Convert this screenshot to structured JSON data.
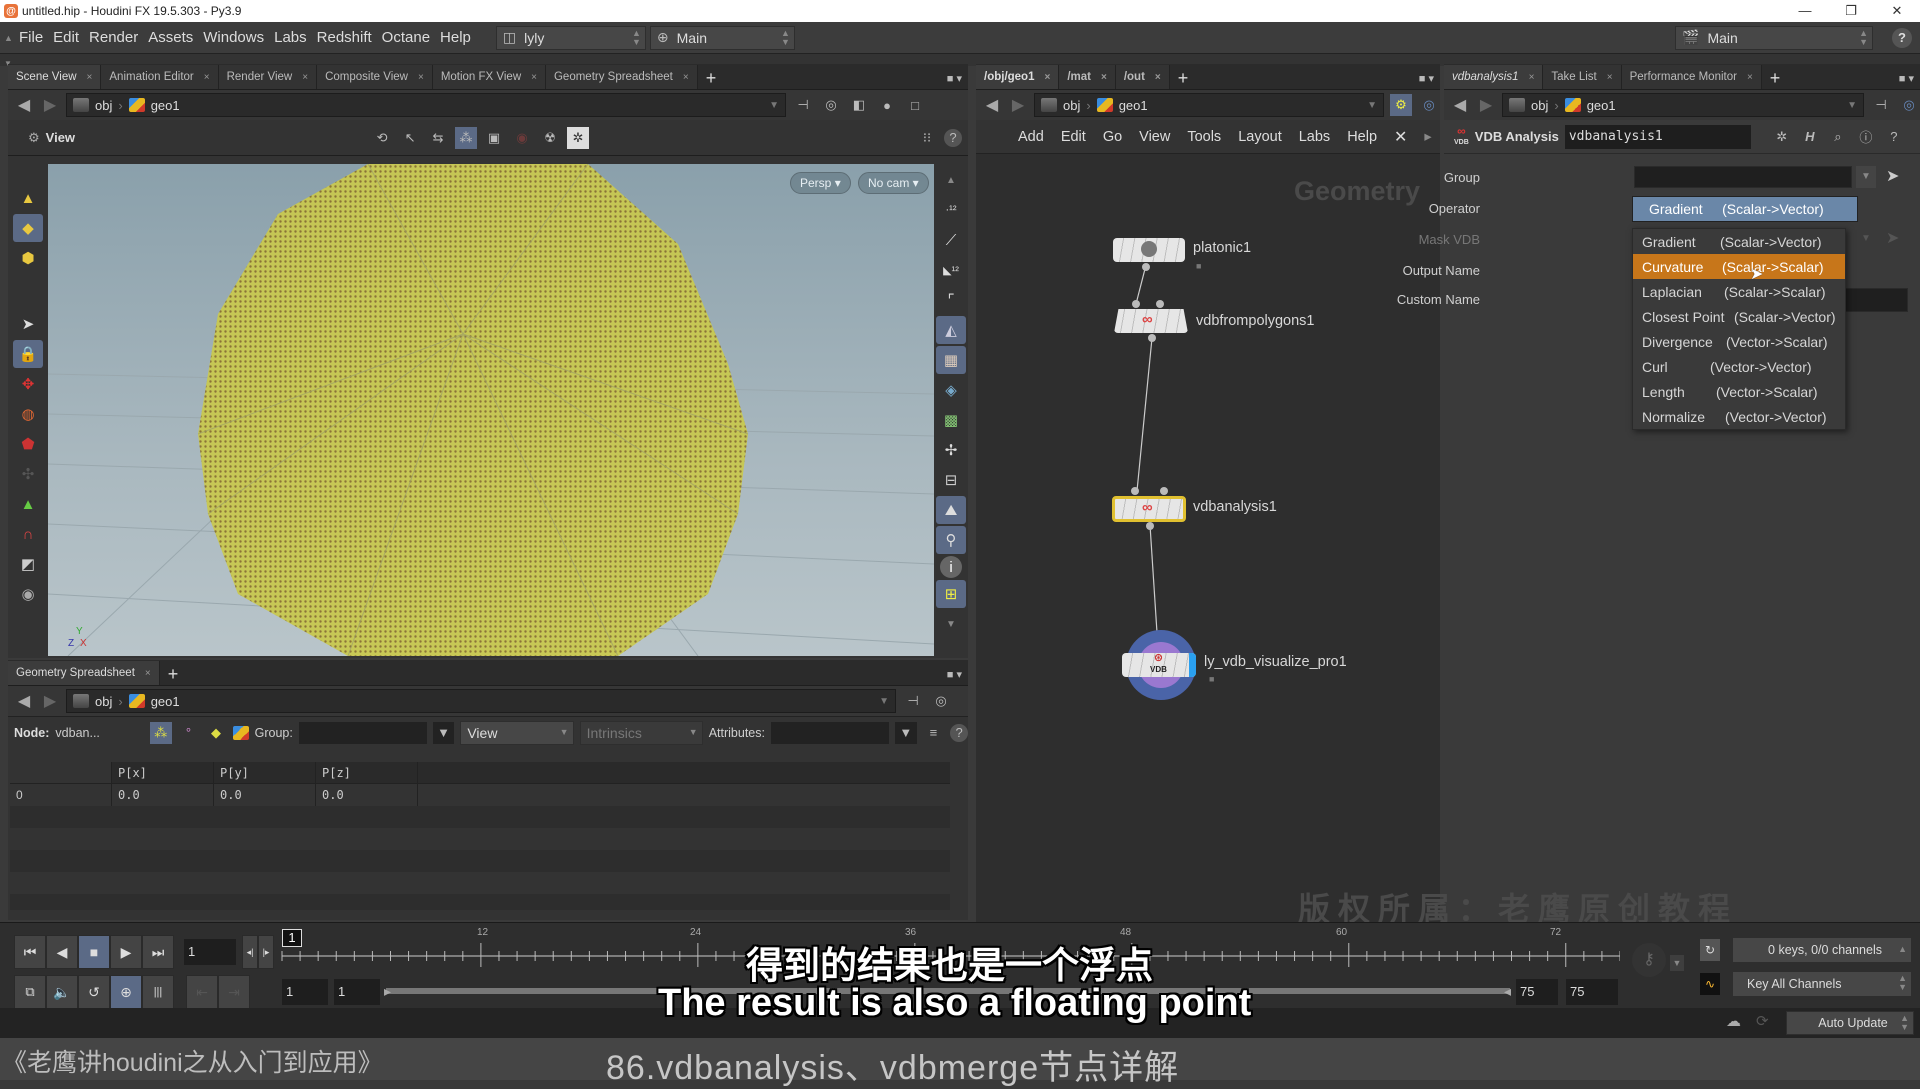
{
  "window": {
    "title": "untitled.hip - Houdini FX 19.5.303 - Py3.9",
    "controls": [
      "—",
      "❐",
      "✕"
    ]
  },
  "menubar": {
    "items": [
      "File",
      "Edit",
      "Render",
      "Assets",
      "Windows",
      "Labs",
      "Redshift",
      "Octane",
      "Help"
    ],
    "desktop": "lyly",
    "context": "Main",
    "right_context": "Main"
  },
  "left_pane": {
    "tabs": [
      {
        "label": "Scene View",
        "active": true
      },
      {
        "label": "Animation Editor"
      },
      {
        "label": "Render View"
      },
      {
        "label": "Composite View"
      },
      {
        "label": "Motion FX View"
      },
      {
        "label": "Geometry Spreadsheet"
      }
    ],
    "path": [
      "obj",
      "geo1"
    ],
    "viewer_label": "View",
    "persp_button": "Persp",
    "cam_button": "No cam",
    "axis_labels": {
      "y": "Y",
      "z": "Z",
      "x": "X"
    }
  },
  "spreadsheet": {
    "tab": "Geometry Spreadsheet",
    "path": [
      "obj",
      "geo1"
    ],
    "node_label": "Node:",
    "node_value": "vdban...",
    "group_label": "Group:",
    "group_value": "",
    "view_select": "View",
    "intrinsics_select": "Intrinsics",
    "attributes_label": "Attributes:",
    "columns": [
      "",
      "P[x]",
      "P[y]",
      "P[z]"
    ],
    "rows": [
      [
        "0",
        "0.0",
        "0.0",
        "0.0"
      ]
    ]
  },
  "network": {
    "tabs": [
      {
        "label": "/obj/geo1",
        "active": true
      },
      {
        "label": "/mat"
      },
      {
        "label": "/out"
      }
    ],
    "path": [
      "obj",
      "geo1"
    ],
    "menu": [
      "Add",
      "Edit",
      "Go",
      "View",
      "Tools",
      "Layout",
      "Labs",
      "Help"
    ],
    "context_watermark": "Geometry",
    "nodes": [
      {
        "name": "platonic1"
      },
      {
        "name": "vdbfrompolygons1"
      },
      {
        "name": "vdbanalysis1",
        "selected": true
      },
      {
        "name": "ly_vdb_visualize_pro1",
        "display": true
      }
    ]
  },
  "params": {
    "tabs": [
      {
        "label": "vdbanalysis1",
        "active": true
      },
      {
        "label": "Take List"
      },
      {
        "label": "Performance Monitor"
      }
    ],
    "path": [
      "obj",
      "geo1"
    ],
    "node_type": "VDB Analysis",
    "node_name": "vdbanalysis1",
    "fields": [
      {
        "label": "Group",
        "value": ""
      },
      {
        "label": "Operator",
        "value": "Gradient     (Scalar->Vector)"
      },
      {
        "label": "Mask VDB",
        "value": "",
        "disabled": true
      },
      {
        "label": "Output Name",
        "value": ""
      },
      {
        "label": "Custom Name",
        "value": ""
      }
    ],
    "operator_menu": [
      {
        "name": "Gradient",
        "type": "(Scalar->Vector)"
      },
      {
        "name": "Curvature",
        "type": "(Scalar->Scalar)",
        "highlighted": true
      },
      {
        "name": "Laplacian",
        "type": "(Scalar->Scalar)"
      },
      {
        "name": "Closest Point",
        "type": "(Scalar->Vector)"
      },
      {
        "name": "Divergence",
        "type": "(Vector->Scalar)"
      },
      {
        "name": "Curl",
        "type": "(Vector->Vector)"
      },
      {
        "name": "Length",
        "type": "(Vector->Scalar)"
      },
      {
        "name": "Normalize",
        "type": "(Vector->Vector)"
      }
    ],
    "highlight_color": "#c7761a"
  },
  "playbar": {
    "current_frame": "1",
    "frame_marker": "1",
    "ticks": [
      "12",
      "24",
      "36",
      "48",
      "60",
      "72"
    ],
    "range_start": "1",
    "range_start2": "1",
    "range_end": "75",
    "range_end2": "75",
    "keys_status": "0 keys, 0/0 channels",
    "key_mode": "Key All Channels",
    "update_mode": "Auto Update"
  },
  "overlay": {
    "subtitle_cn": "得到的结果也是一个浮点",
    "subtitle_en": "The result is also a floating point",
    "watermark": "版权所属：老鹰原创教程",
    "course_title": "《老鹰讲houdini之从入门到应用》",
    "lesson_title": "86.vdbanalysis、vdbmerge节点详解"
  }
}
